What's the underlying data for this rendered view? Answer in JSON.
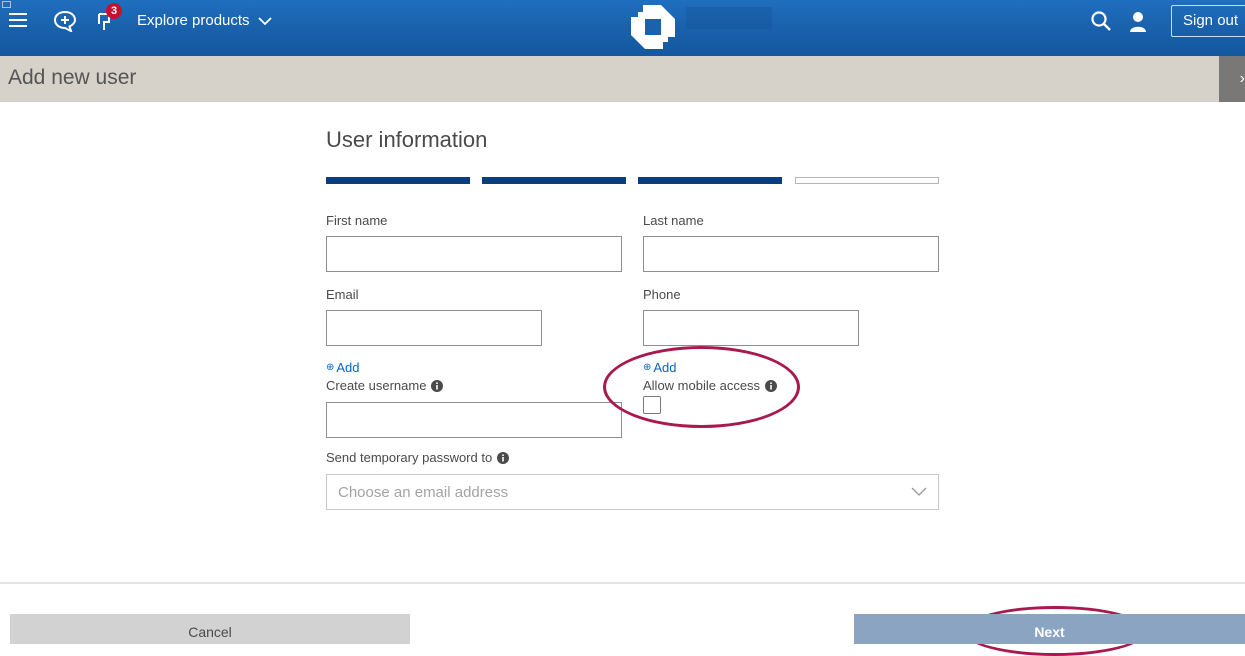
{
  "header": {
    "notification_count": "3",
    "explore_label": "Explore products",
    "sign_out_label": "Sign out",
    "icons": [
      "menu-icon",
      "feedback-icon",
      "notification-icon",
      "chevron-down-icon",
      "logo-icon",
      "search-icon",
      "user-icon"
    ]
  },
  "page": {
    "title": "Add new user",
    "close_label": "›"
  },
  "form": {
    "section_title": "User information",
    "progress": {
      "steps_total": 4,
      "steps_completed": 3
    },
    "first_name": {
      "label": "First name",
      "value": ""
    },
    "last_name": {
      "label": "Last name",
      "value": ""
    },
    "email": {
      "label": "Email",
      "value": "",
      "add_label": "Add"
    },
    "phone": {
      "label": "Phone",
      "value": "",
      "add_label": "Add"
    },
    "username": {
      "label": "Create username",
      "value": ""
    },
    "mobile_access": {
      "label": "Allow mobile access",
      "checked": false
    },
    "temp_password": {
      "label": "Send temporary password to",
      "placeholder": "Choose an email address"
    }
  },
  "actions": {
    "cancel_label": "Cancel",
    "next_label": "Next"
  },
  "colors": {
    "nav_blue": "#1a62ad",
    "progress_done": "#0b3e7d",
    "annotation_ring": "#a8194f",
    "next_button": "#8aa4c2",
    "badge": "#c8102e"
  }
}
